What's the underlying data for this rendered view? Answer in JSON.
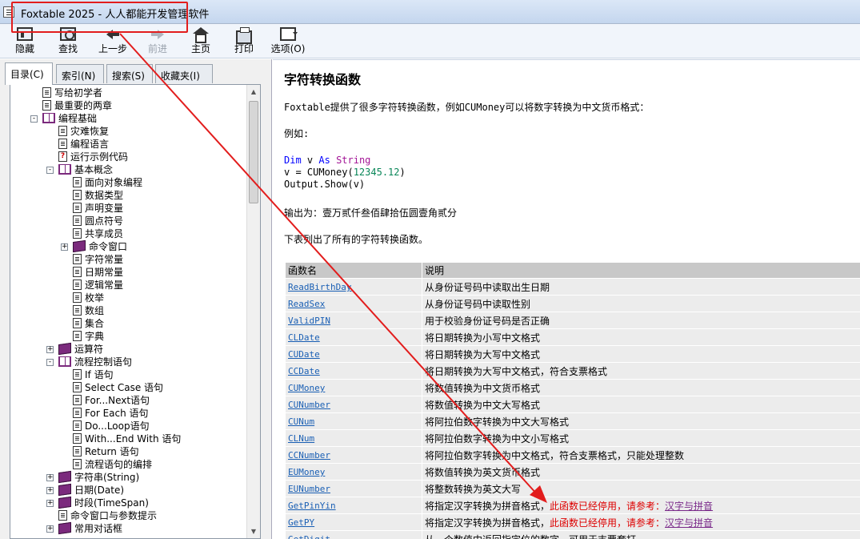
{
  "window": {
    "title": "Foxtable 2025 - 人人都能开发管理软件"
  },
  "toolbar": {
    "hide": "隐藏",
    "find": "查找",
    "back": "上一步",
    "forward": "前进",
    "home": "主页",
    "print": "打印",
    "options": "选项(O)"
  },
  "tabs": [
    "目录(C)",
    "索引(N)",
    "搜索(S)",
    "收藏夹(I)"
  ],
  "tree": [
    {
      "label": "写给初学者",
      "level": 1,
      "icon": "page-icon"
    },
    {
      "label": "最重要的两章",
      "level": 1,
      "icon": "page-icon"
    },
    {
      "label": "编程基础",
      "level": 1,
      "icon": "openbook-icon",
      "expander": "-"
    },
    {
      "label": "灾难恢复",
      "level": 2,
      "icon": "page-icon"
    },
    {
      "label": "编程语言",
      "level": 2,
      "icon": "page-icon"
    },
    {
      "label": "运行示例代码",
      "level": 2,
      "icon": "help-icon"
    },
    {
      "label": "基本概念",
      "level": 2,
      "icon": "openbook-icon",
      "expander": "-"
    },
    {
      "label": "面向对象编程",
      "level": 3,
      "icon": "page-icon"
    },
    {
      "label": "数据类型",
      "level": 3,
      "icon": "page-icon"
    },
    {
      "label": "声明变量",
      "level": 3,
      "icon": "page-icon"
    },
    {
      "label": "圆点符号",
      "level": 3,
      "icon": "page-icon"
    },
    {
      "label": "共享成员",
      "level": 3,
      "icon": "page-icon"
    },
    {
      "label": "命令窗口",
      "level": 3,
      "icon": "book-icon",
      "expander": "+"
    },
    {
      "label": "字符常量",
      "level": 3,
      "icon": "page-icon"
    },
    {
      "label": "日期常量",
      "level": 3,
      "icon": "page-icon"
    },
    {
      "label": "逻辑常量",
      "level": 3,
      "icon": "page-icon"
    },
    {
      "label": "枚举",
      "level": 3,
      "icon": "page-icon"
    },
    {
      "label": "数组",
      "level": 3,
      "icon": "page-icon"
    },
    {
      "label": "集合",
      "level": 3,
      "icon": "page-icon"
    },
    {
      "label": "字典",
      "level": 3,
      "icon": "page-icon"
    },
    {
      "label": "运算符",
      "level": 2,
      "icon": "book-icon",
      "expander": "+"
    },
    {
      "label": "流程控制语句",
      "level": 2,
      "icon": "openbook-icon",
      "expander": "-"
    },
    {
      "label": "If 语句",
      "level": 3,
      "icon": "page-icon"
    },
    {
      "label": "Select Case 语句",
      "level": 3,
      "icon": "page-icon"
    },
    {
      "label": "For...Next语句",
      "level": 3,
      "icon": "page-icon"
    },
    {
      "label": "For Each 语句",
      "level": 3,
      "icon": "page-icon"
    },
    {
      "label": "Do...Loop语句",
      "level": 3,
      "icon": "page-icon"
    },
    {
      "label": "With...End With 语句",
      "level": 3,
      "icon": "page-icon"
    },
    {
      "label": "Return 语句",
      "level": 3,
      "icon": "page-icon"
    },
    {
      "label": "流程语句的编排",
      "level": 3,
      "icon": "page-icon"
    },
    {
      "label": "字符串(String)",
      "level": 2,
      "icon": "book-icon",
      "expander": "+"
    },
    {
      "label": "日期(Date)",
      "level": 2,
      "icon": "book-icon",
      "expander": "+"
    },
    {
      "label": "时段(TimeSpan)",
      "level": 2,
      "icon": "book-icon",
      "expander": "+"
    },
    {
      "label": "命令窗口与参数提示",
      "level": 2,
      "icon": "page-icon"
    },
    {
      "label": "常用对话框",
      "level": 2,
      "icon": "book-icon",
      "expander": "+"
    }
  ],
  "content": {
    "heading": "字符转换函数",
    "intro": "Foxtable提供了很多字符转换函数，例如CUMoney可以将数字转换为中文货币格式：",
    "example_label": "例如:",
    "code": {
      "line1_kw1": "Dim",
      "line1_var": " v ",
      "line1_kw2": "As",
      "line1_type": "String",
      "line2_pre": "v = CUMoney(",
      "line2_num": "12345.12",
      "line2_post": ")",
      "line3": "Output.Show(v)"
    },
    "output_text": "输出为：壹万贰仟叁佰肆拾伍圆壹角贰分",
    "list_intro": "下表列出了所有的字符转换函数。",
    "table": {
      "headers": [
        "函数名",
        "说明"
      ],
      "rows": [
        {
          "name": "ReadBirthDay",
          "desc": "从身份证号码中读取出生日期"
        },
        {
          "name": "ReadSex",
          "desc": "从身份证号码中读取性别"
        },
        {
          "name": "ValidPIN",
          "desc": "用于校验身份证号码是否正确"
        },
        {
          "name": "CLDate",
          "desc": "将日期转换为小写中文格式"
        },
        {
          "name": "CUDate",
          "desc": "将日期转换为大写中文格式"
        },
        {
          "name": "CCDate",
          "desc": "将日期转换为大写中文格式，符合支票格式"
        },
        {
          "name": "CUMoney",
          "desc": "将数值转换为中文货币格式"
        },
        {
          "name": "CUNumber",
          "desc": "将数值转换为中文大写格式"
        },
        {
          "name": "CUNum",
          "desc": "将阿拉伯数字转换为中文大写格式"
        },
        {
          "name": "CLNum",
          "desc": "将阿拉伯数字转换为中文小写格式"
        },
        {
          "name": "CCNumber",
          "desc": "将阿拉伯数字转换为中文格式，符合支票格式，只能处理整数"
        },
        {
          "name": "EUMoney",
          "desc": "将数值转换为英文货币格式"
        },
        {
          "name": "EUNumber",
          "desc": "将整数转换为英文大写"
        },
        {
          "name": "GetPinYin",
          "desc": "将指定汉字转换为拼音格式，",
          "warn": "此函数已经停用，请参考：",
          "see": "汉字与拼音"
        },
        {
          "name": "GetPY",
          "desc": "将指定汉字转换为拼音格式，",
          "warn": "此函数已经停用，请参考：",
          "see": "汉字与拼音"
        },
        {
          "name": "GetDigit",
          "desc": "从一个数值中返回指定位的数字，可用于支票套打"
        }
      ]
    }
  },
  "colors": {
    "accent_red": "#e21d1d",
    "link": "#1a5fb4",
    "warning": "#dd0000"
  }
}
